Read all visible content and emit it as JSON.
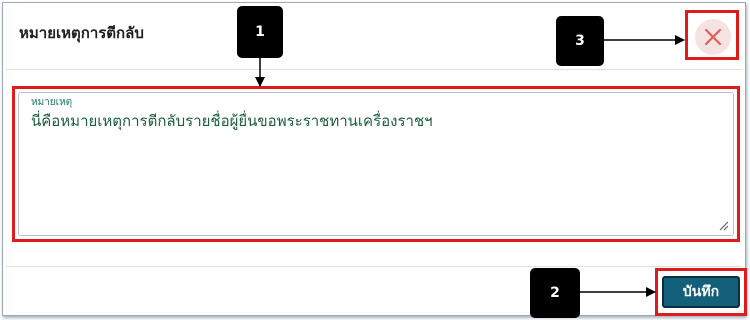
{
  "dialog": {
    "title": "หมายเหตุการตีกลับ"
  },
  "remark_field": {
    "label": "หมายเหตุ",
    "value": "นี่คือหมายเหตุการตีกลับรายชื่อผู้ยื่นขอพระราชทานเครื่องราชฯ"
  },
  "buttons": {
    "save_label": "บันทึก"
  },
  "callouts": {
    "one": "1",
    "two": "2",
    "three": "3"
  },
  "colors": {
    "highlight": "#e01b1b",
    "save_button": "#14607a",
    "label_green": "#1e7a5a"
  }
}
